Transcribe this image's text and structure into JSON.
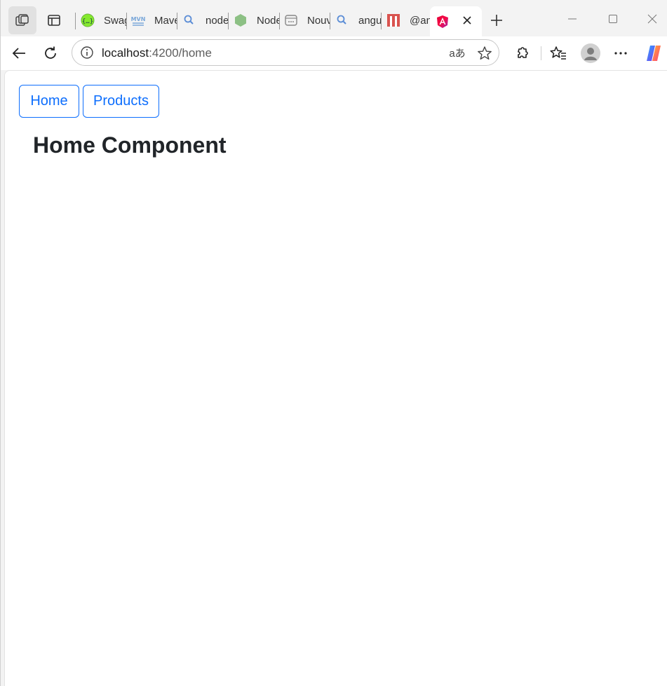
{
  "browser": {
    "tabs": [
      {
        "title": "Swagger",
        "icon": "swagger-icon"
      },
      {
        "title": "Maven",
        "icon": "mvn-icon"
      },
      {
        "title": "node",
        "icon": "search-icon"
      },
      {
        "title": "Node",
        "icon": "nodejs-icon"
      },
      {
        "title": "Nouv",
        "icon": "page-icon"
      },
      {
        "title": "angu",
        "icon": "search-icon"
      },
      {
        "title": "@ang",
        "icon": "gitlab-icon"
      },
      {
        "title": "",
        "icon": "angular-icon",
        "active": true
      }
    ],
    "address": {
      "host": "localhost",
      "path": ":4200/home"
    },
    "translate_glyph": "aあ"
  },
  "app": {
    "nav": {
      "home_label": "Home",
      "products_label": "Products"
    },
    "heading": "Home Component"
  },
  "colors": {
    "accent": "#0d6efd",
    "heading": "#212529"
  }
}
